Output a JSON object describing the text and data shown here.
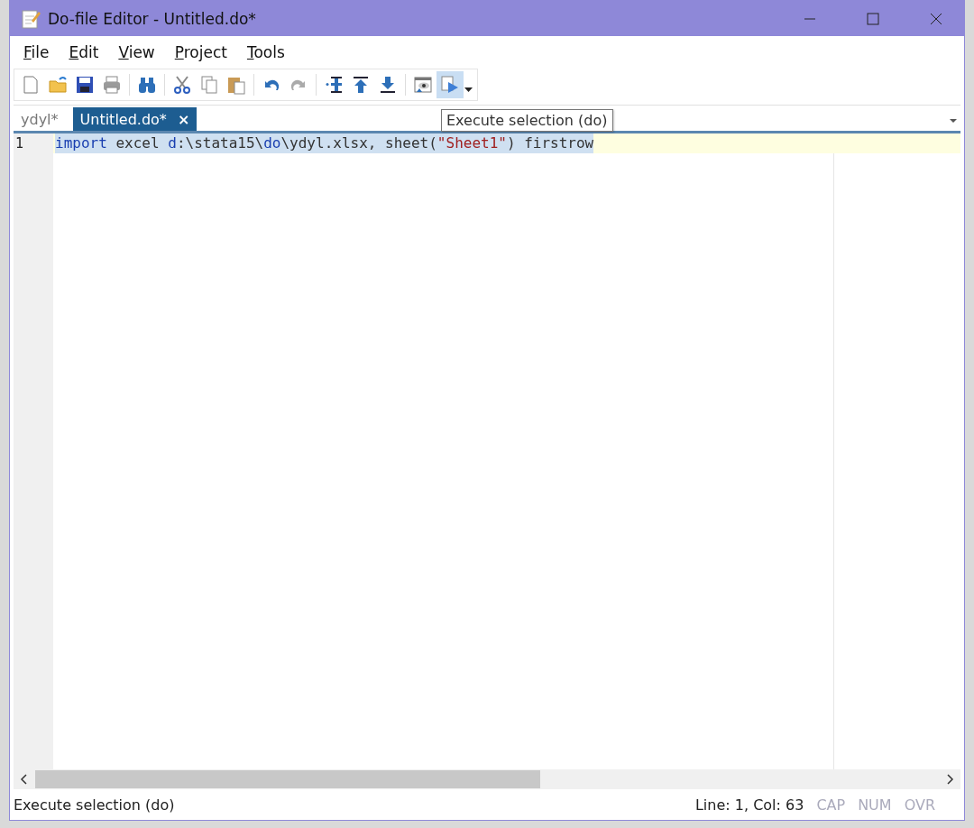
{
  "window": {
    "title": "Do-file Editor - Untitled.do*"
  },
  "menu": [
    {
      "label": "File"
    },
    {
      "label": "Edit"
    },
    {
      "label": "View"
    },
    {
      "label": "Project"
    },
    {
      "label": "Tools"
    }
  ],
  "toolbar": [
    [
      {
        "kind": "new",
        "highlighted": false
      },
      {
        "kind": "open",
        "highlighted": false
      },
      {
        "kind": "save",
        "highlighted": false
      },
      {
        "kind": "print",
        "highlighted": false
      }
    ],
    [
      {
        "kind": "find",
        "highlighted": false
      }
    ],
    [
      {
        "kind": "cut",
        "highlighted": false
      },
      {
        "kind": "copy",
        "highlighted": false
      },
      {
        "kind": "paste",
        "highlighted": false
      }
    ],
    [
      {
        "kind": "undo",
        "highlighted": false
      },
      {
        "kind": "redo",
        "highlighted": false
      }
    ],
    [
      {
        "kind": "bookmark",
        "highlighted": false
      },
      {
        "kind": "prev",
        "highlighted": false
      },
      {
        "kind": "next",
        "highlighted": false
      }
    ],
    [
      {
        "kind": "preview",
        "highlighted": false
      },
      {
        "kind": "execute",
        "highlighted": true
      }
    ]
  ],
  "tabs": [
    {
      "label": "ydyl*",
      "selected": false
    },
    {
      "label": "Untitled.do*",
      "selected": true,
      "close": "×"
    }
  ],
  "tooltip": "Execute selection (do)",
  "editor": {
    "lines": [
      {
        "number": "1",
        "selected": true,
        "tokens": [
          {
            "kind": "keyword",
            "text": "import"
          },
          {
            "kind": "plain",
            "text": " excel "
          },
          {
            "kind": "keyword",
            "text": "d"
          },
          {
            "kind": "plain",
            "text": ":\\stata15\\"
          },
          {
            "kind": "keyword",
            "text": "do"
          },
          {
            "kind": "plain",
            "text": "\\ydyl.xlsx, sheet("
          },
          {
            "kind": "string",
            "text": "\"Sheet1\""
          },
          {
            "kind": "plain",
            "text": ") firstrow"
          }
        ]
      }
    ]
  },
  "status_bar": {
    "message": "Execute selection (do)",
    "position": "Line: 1, Col: 63",
    "indicators": [
      {
        "label": "CAP",
        "on": false
      },
      {
        "label": "NUM",
        "on": false
      },
      {
        "label": "OVR",
        "on": false
      }
    ]
  }
}
